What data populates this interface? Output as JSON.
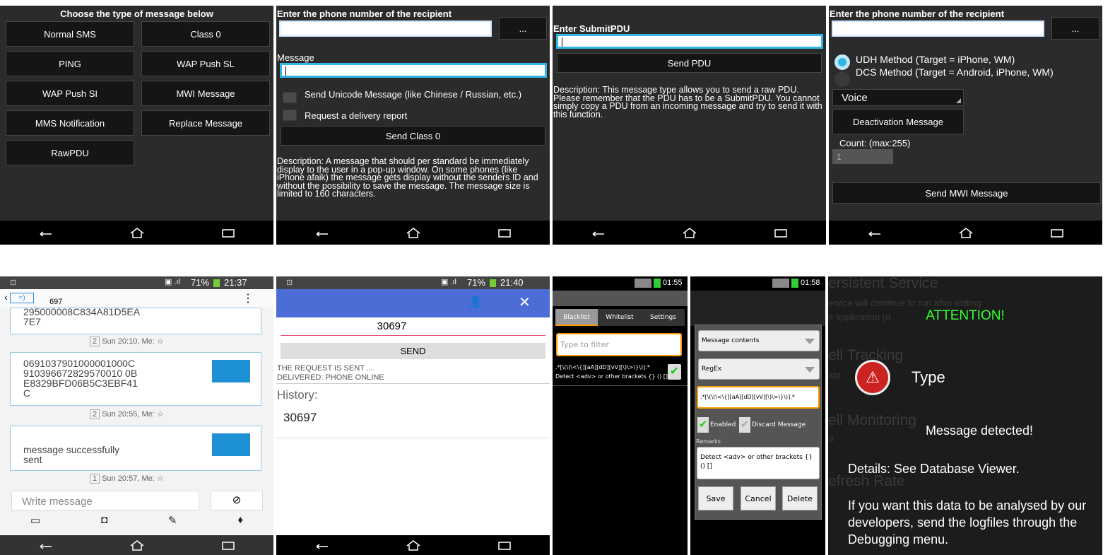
{
  "p1": {
    "title": "Choose the type of message below",
    "buttons": [
      "Normal SMS",
      "Class 0",
      "PING",
      "WAP Push SL",
      "WAP Push SI",
      "MWI Message",
      "MMS Notification",
      "Replace Message",
      "RawPDU"
    ]
  },
  "p2": {
    "recipient_label": "Enter the phone number of the recipient",
    "picker": "...",
    "message_label": "Message",
    "unicode_label": "Send Unicode Message (like Chinese / Russian, etc.)",
    "report_label": "Request a delivery report",
    "send_button": "Send Class 0",
    "description": "Description: A message that should per standard be immediately display to the user in a pop-up window. On some phones (like iPhone afaik) the message gets display without the senders ID and without the possibility to save the message. The message size is limited to 160 characters."
  },
  "p3": {
    "label": "Enter SubmitPDU",
    "send_button": "Send PDU",
    "description": "Description: This message type allows you to send a raw PDU. Please remember that the PDU has to be a SubmitPDU. You cannot simply copy a PDU from an incoming message and try to send it with this function."
  },
  "p4": {
    "recipient_label": "Enter the phone number of the recipient",
    "picker": "...",
    "udh_label": "UDH Method (Target = iPhone, WM)",
    "dcs_label": "DCS Method (Target = Android, iPhone, WM)",
    "voice_select": "Voice",
    "deactivation_select": "Deactivation Message",
    "count_label": "Count: (max:255)",
    "count_value": "1",
    "send_button": "Send MWI Message"
  },
  "p5": {
    "battery": "71%",
    "time": "21:37",
    "contact": "697",
    "bubble1_text": "295000008C834A81D5EA\n7E7",
    "bubble1_count": "2",
    "bubble1_meta": "Sun 20:10, Me:",
    "bubble2_text": "0691037901000001000C\n910396672829570010 0B\nE8329BFD06B5C3EBF41\nC",
    "bubble2_count": "2",
    "bubble2_meta": "Sun 20:55, Me:",
    "bubble3_text": "message successfully\nsent",
    "bubble3_count": "1",
    "bubble3_meta": "Sun 20:57, Me:",
    "compose_placeholder": "Write message"
  },
  "p6": {
    "battery": "71%",
    "time": "21:40",
    "number": "30697",
    "send_button": "SEND",
    "status1": "THE REQUEST IS SENT ...",
    "status2": "DELIVERED: PHONE ONLINE",
    "history_label": "History:",
    "history_item": "30697"
  },
  "p7": {
    "time": "01:55",
    "tabs": [
      "Blacklist",
      "Whitelist",
      "Settings"
    ],
    "filter_placeholder": "Type to filter",
    "rule_regex": ".*[\\(\\(\\<\\{][aA][dD][vV][\\)\\>\\}\\)].*",
    "rule_remark": "Detect <adv> or other brackets {} () []"
  },
  "p8": {
    "time": "01:58",
    "select1": "Message contents",
    "select2": "RegEx",
    "regex_value": ".*[\\(\\(\\<\\{][aA][dD][vV][\\)\\>\\}\\)].*",
    "enabled_label": "Enabled",
    "discard_label": "Discard Message",
    "remarks_label": "Remarks",
    "remarks_value": "Detect <adv> or other brackets {} () []",
    "save": "Save",
    "cancel": "Cancel",
    "delete": "Delete"
  },
  "p9": {
    "bg_lines": [
      "ersistent Service",
      "ervice will continue to run after exiting",
      "e application (d",
      "ell Tracking",
      "ata",
      "ell Monitoring",
      "d",
      "efresh Rate"
    ],
    "attention": "ATTENTION!",
    "type_label": "Type",
    "detected": "Message detected!",
    "details": "Details: See Database Viewer.",
    "analyse": "If you want this data to be analysed by our developers, send the logfiles through the Debugging menu."
  }
}
